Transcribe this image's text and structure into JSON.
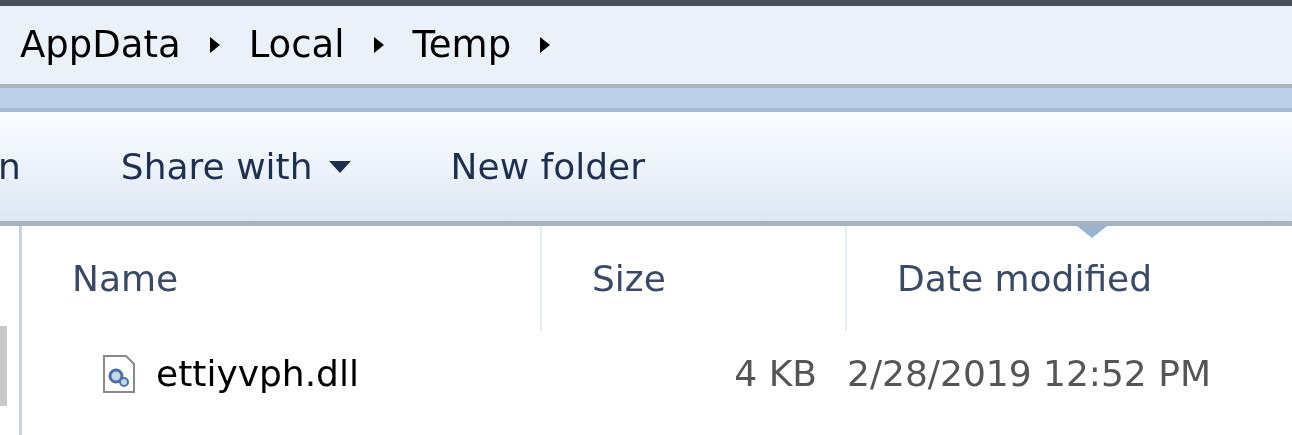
{
  "breadcrumb": [
    "AppData",
    "Local",
    "Temp"
  ],
  "toolbar": [
    {
      "label": "n",
      "dropdown": false
    },
    {
      "label": "Share with",
      "dropdown": true
    },
    {
      "label": "New folder",
      "dropdown": false
    }
  ],
  "columns": [
    {
      "label": "Name",
      "sorted": false
    },
    {
      "label": "Size",
      "sorted": false
    },
    {
      "label": "Date modified",
      "sorted": true
    }
  ],
  "rows": [
    {
      "name": "ettiyvph.dll",
      "size": "4 KB",
      "date": "2/28/2019 12:52 PM"
    }
  ]
}
